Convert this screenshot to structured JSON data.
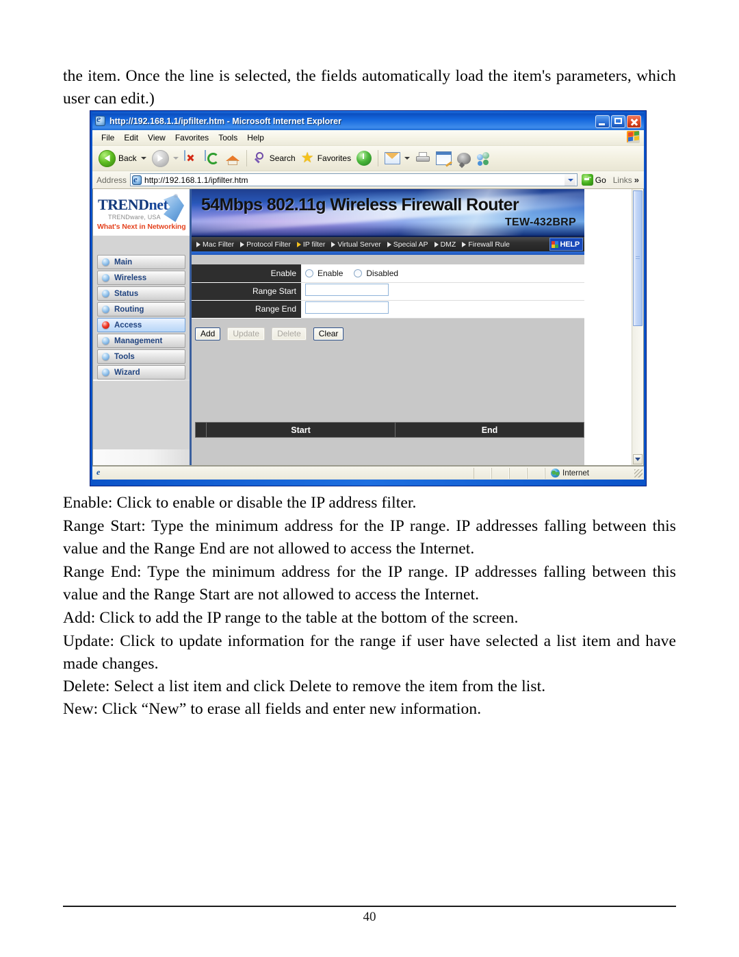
{
  "document": {
    "top_paragraph": "the item. Once the line is selected, the fields automatically load the item's parameters, which user can edit.)",
    "paragraphs": [
      "Enable: Click to enable or disable the IP address filter.",
      "Range Start: Type the minimum address for the IP range. IP addresses falling between this value and the Range End are not allowed to access the Internet.",
      "Range End: Type the minimum address for the IP range. IP addresses falling between this value and the Range Start are not allowed to access the Internet.",
      "Add: Click to add the IP range to the table at the bottom of the screen.",
      "Update: Click to update information for the range if user have selected a list item and have made changes.",
      "Delete: Select a list item and click Delete to remove the item from the list.",
      "New: Click “New” to erase all fields and enter new information."
    ],
    "page_number": "40"
  },
  "browser": {
    "title": "http://192.168.1.1/ipfilter.htm - Microsoft Internet Explorer",
    "title_icon": "ie-icon",
    "window_controls": [
      "minimize",
      "maximize",
      "close"
    ],
    "menu": [
      "File",
      "Edit",
      "View",
      "Favorites",
      "Tools",
      "Help"
    ],
    "toolbar": {
      "back_label": "Back",
      "search_label": "Search",
      "favorites_label": "Favorites",
      "icons": [
        "back-icon",
        "forward-icon",
        "stop-icon",
        "refresh-icon",
        "home-icon",
        "search-icon",
        "favorites-icon",
        "history-icon",
        "mail-icon",
        "print-icon",
        "edit-icon",
        "discuss-icon",
        "messenger-icon"
      ]
    },
    "address": {
      "label": "Address",
      "value": "http://192.168.1.1/ipfilter.htm",
      "go_label": "Go",
      "links_label": "Links"
    },
    "status": {
      "zone": "Internet"
    }
  },
  "router": {
    "brand": {
      "name_trend": "TREND",
      "name_net": "net",
      "registered": "®",
      "sub1": "TRENDware, USA",
      "sub2": "What's Next in Networking"
    },
    "hero": {
      "title": "54Mbps 802.11g Wireless Firewall Router",
      "model": "TEW-432BRP"
    },
    "nav": [
      {
        "label": "Mac Filter",
        "active": false
      },
      {
        "label": "Protocol Filter",
        "active": false
      },
      {
        "label": "IP filter",
        "active": true
      },
      {
        "label": "Virtual Server",
        "active": false
      },
      {
        "label": "Special AP",
        "active": false
      },
      {
        "label": "DMZ",
        "active": false
      },
      {
        "label": "Firewall Rule",
        "active": false
      }
    ],
    "help_label": "HELP",
    "sidebar": [
      {
        "label": "Main",
        "active": false
      },
      {
        "label": "Wireless",
        "active": false
      },
      {
        "label": "Status",
        "active": false
      },
      {
        "label": "Routing",
        "active": false
      },
      {
        "label": "Access",
        "active": true
      },
      {
        "label": "Management",
        "active": false
      },
      {
        "label": "Tools",
        "active": false
      },
      {
        "label": "Wizard",
        "active": false
      }
    ],
    "form": {
      "enable_label": "Enable",
      "radio_enable": "Enable",
      "radio_disabled": "Disabled",
      "range_start_label": "Range Start",
      "range_start_value": "",
      "range_end_label": "Range End",
      "range_end_value": ""
    },
    "buttons": [
      {
        "label": "Add",
        "disabled": false
      },
      {
        "label": "Update",
        "disabled": true
      },
      {
        "label": "Delete",
        "disabled": true
      },
      {
        "label": "Clear",
        "disabled": false
      }
    ],
    "list_table": {
      "headers": [
        "Start",
        "End"
      ],
      "rows": []
    }
  }
}
